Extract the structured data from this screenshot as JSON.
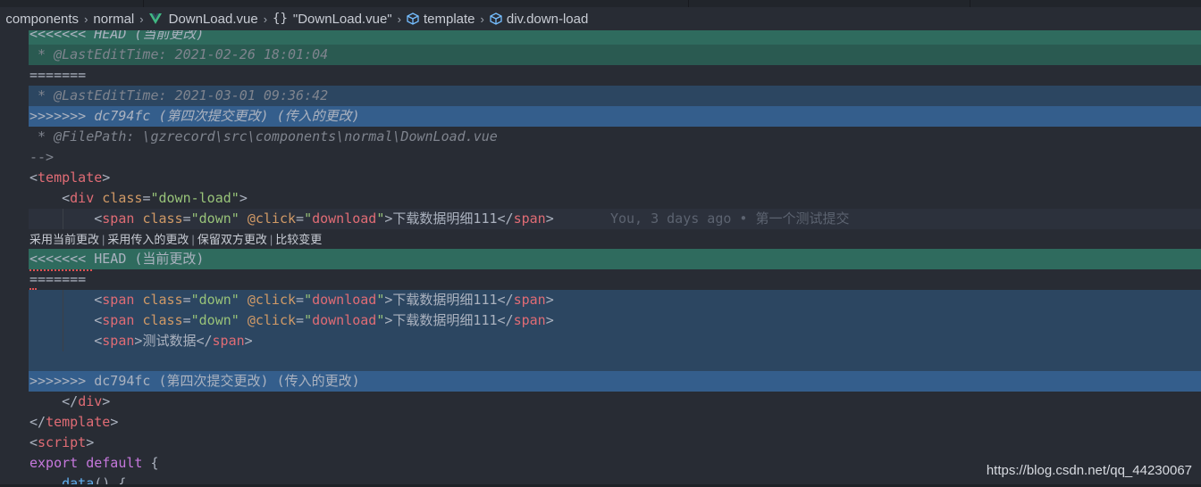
{
  "breadcrumb": {
    "items": [
      "components",
      "normal",
      "DownLoad.vue",
      "\"DownLoad.vue\"",
      "template",
      "div.down-load"
    ]
  },
  "editor": {
    "head_marker_top": "<<<<<<< HEAD (当前更改)",
    "current_edit_time": " * @LastEditTime: 2021-02-26 18:01:04",
    "separator_top": "=======",
    "incoming_edit_time": " * @LastEditTime: 2021-03-01 09:36:42",
    "incoming_marker_top": ">>>>>>> dc794fc (第四次提交更改) (传入的更改)",
    "filepath": " * @FilePath: \\gzrecord\\src\\components\\normal\\DownLoad.vue",
    "comment_end": "-->",
    "template_open": "template",
    "div_tag": "div",
    "div_attr": "class",
    "div_value": "\"down-load\"",
    "span_tag": "span",
    "span_attr_class": "class",
    "span_value_class": "\"down\"",
    "span_attr_click": "@click",
    "span_value_click_q1": "\"",
    "span_value_click_word": "download",
    "span_value_click_q2": "\"",
    "span_text": "下载数据明细111",
    "span_text2": "测试数据",
    "blame": "You, 3 days ago • 第一个测试提交",
    "codelens": [
      "采用当前更改",
      "采用传入的更改",
      "保留双方更改",
      "比较变更"
    ],
    "head_marker_bottom": "<<<<<<< HEAD (当前更改)",
    "separator_bottom": "=======",
    "incoming_marker_bottom": ">>>>>>> dc794fc (第四次提交更改) (传入的更改)",
    "div_close": "div",
    "template_close": "template",
    "script_tag": "script",
    "kw_export": "export",
    "kw_default": "default",
    "brace_open": " {",
    "data_fn": "data",
    "data_tail": "() {"
  },
  "watermark": "https://blog.csdn.net/qq_44230067"
}
